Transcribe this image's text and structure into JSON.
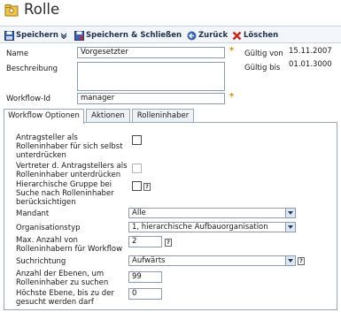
{
  "header": {
    "title": "Rolle"
  },
  "toolbar": {
    "save_label": "Speichern",
    "save_close_label": "Speichern & Schließen",
    "back_label": "Zurück",
    "delete_label": "Löschen"
  },
  "form": {
    "name_label": "Name",
    "name_value": "Vorgesetzter",
    "description_label": "Beschreibung",
    "description_value": "",
    "workflow_id_label": "Workflow-Id",
    "workflow_id_value": "manager",
    "required_mark": "*",
    "valid_from_label": "Gültig von",
    "valid_from_value": "15.11.2007",
    "valid_to_label": "Gültig bis",
    "valid_to_value": "01.01.3000"
  },
  "tabs": [
    {
      "label": "Workflow Optionen",
      "active": true
    },
    {
      "label": "Aktionen",
      "active": false
    },
    {
      "label": "Rolleninhaber",
      "active": false
    }
  ],
  "options": {
    "suppress_applicant_label": "Antragsteller als Rolleninhaber für sich selbst unterdrücken",
    "suppress_applicant_checked": false,
    "suppress_deputy_label": "Vertreter d. Antragstellers als Rolleninhaber unterdrücken",
    "suppress_deputy_checked": false,
    "hierarchical_group_label": "Hierarchische Gruppe bei Suche nach Rolleninhaber berücksichtigen",
    "hierarchical_group_checked": false,
    "mandant_label": "Mandant",
    "mandant_value": "Alle",
    "org_type_label": "Organisationstyp",
    "org_type_value": "1, hierarchische Aufbauorganisation",
    "max_holders_label": "Max. Anzahl von Rolleninhabern für Workflow",
    "max_holders_value": "2",
    "search_direction_label": "Suchrichtung",
    "search_direction_value": "Aufwärts",
    "levels_label": "Anzahl der Ebenen, um Rolleninhaber zu suchen",
    "levels_value": "99",
    "highest_level_label": "Höchste Ebene, bis zu der gesucht werden darf",
    "highest_level_value": "0",
    "help_glyph": "?"
  },
  "colors": {
    "accent": "#e08a00",
    "border": "#8a9bb3",
    "tab_border": "#9aa8bb",
    "delete_red": "#d0221a"
  }
}
